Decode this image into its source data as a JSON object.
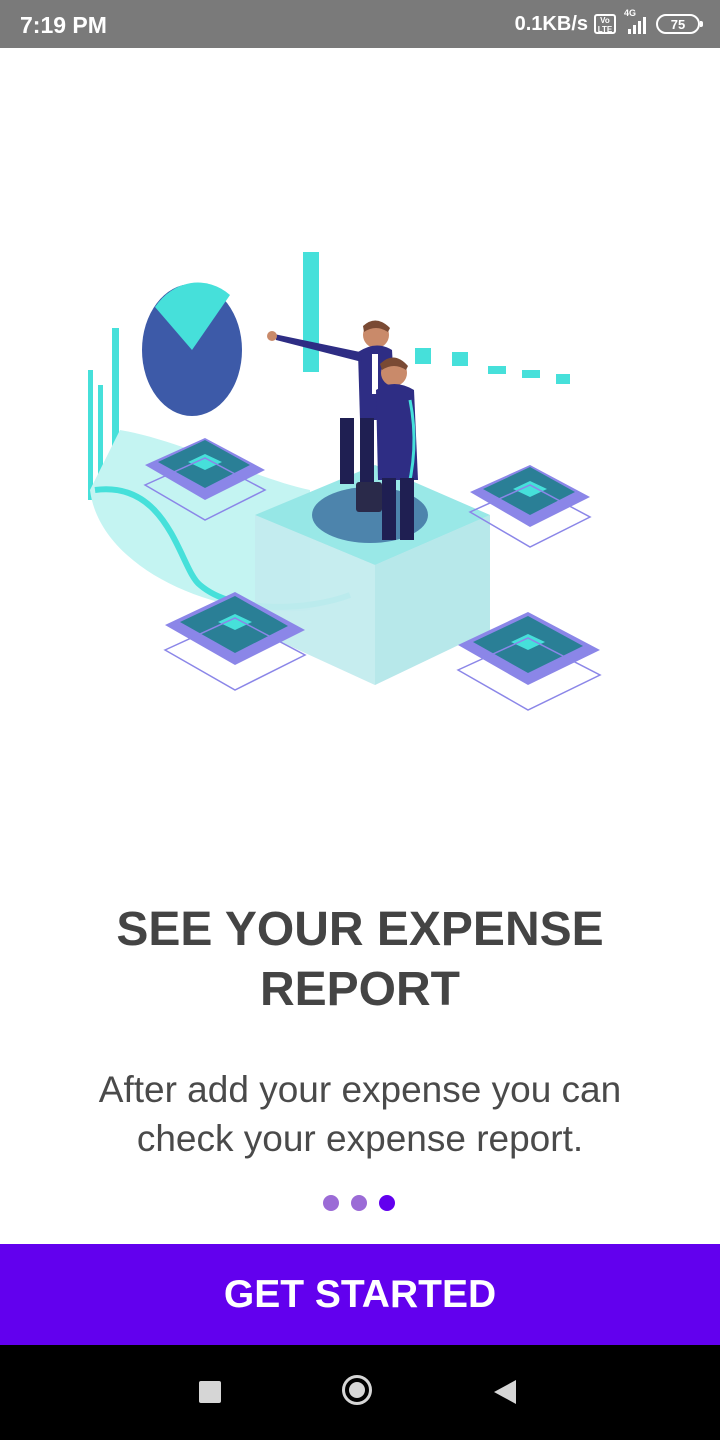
{
  "status_bar": {
    "time": "7:19 PM",
    "net_speed": "0.1KB/s",
    "volte_top": "Vo",
    "volte_bottom": "LTE",
    "network_type": "4G",
    "battery": "75"
  },
  "onboarding": {
    "title_line1": "SEE YOUR EXPENSE",
    "title_line2": "REPORT",
    "description_line1": "After add your expense you can",
    "description_line2": "check your expense report.",
    "page_count": 3,
    "active_page": 3
  },
  "cta": {
    "label": "GET STARTED"
  },
  "colors": {
    "primary": "#6200ee",
    "dot_inactive": "#9b6bd6",
    "status_bar": "#7a7a7a",
    "title_text": "#444444",
    "teal": "#46e0da",
    "chart_blue": "#3d5aa8"
  },
  "icons": {
    "illustration": "isometric-business-report-illustration",
    "nav_recent": "square-icon",
    "nav_home": "circle-icon",
    "nav_back": "triangle-left-icon"
  }
}
